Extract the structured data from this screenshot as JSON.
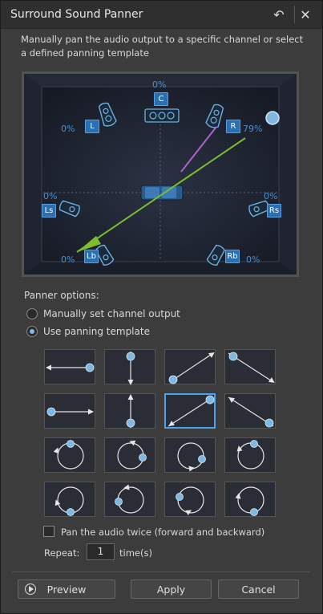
{
  "window": {
    "title": "Surround Sound Panner",
    "description": "Manually pan the audio output to a specific channel or select a defined panning template"
  },
  "panner": {
    "center": {
      "label": "C",
      "percent": "0%"
    },
    "left": {
      "label": "L",
      "percent": "0%"
    },
    "right": {
      "label": "R",
      "percent": "79%"
    },
    "left_surround": {
      "label": "Ls",
      "percent": "0%"
    },
    "right_surround": {
      "label": "Rs",
      "percent": "0%"
    },
    "left_back": {
      "label": "Lb",
      "percent": "0%"
    },
    "right_back": {
      "label": "Rb",
      "percent": "0%"
    },
    "colors": {
      "path": "#7bbd2a",
      "link": "#b060d0",
      "handle": "#7fb8e0",
      "label": "#2b6fb3"
    }
  },
  "options": {
    "section_label": "Panner options:",
    "manual_label": "Manually set channel output",
    "template_label": "Use panning template",
    "selected": "template"
  },
  "templates_selected_index": 6,
  "pan_twice_label": "Pan the audio twice (forward and backward)",
  "repeat": {
    "label": "Repeat:",
    "value": "1",
    "unit": "time(s)"
  },
  "buttons": {
    "preview": "Preview",
    "apply": "Apply",
    "cancel": "Cancel"
  }
}
